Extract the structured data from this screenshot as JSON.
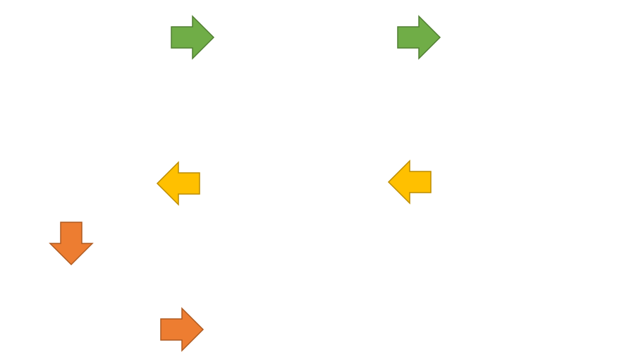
{
  "colors": {
    "green": {
      "fill": "#70AD47",
      "stroke": "#507E32"
    },
    "yellow": {
      "fill": "#FFC000",
      "stroke": "#BC8C00"
    },
    "orange": {
      "fill": "#ED7D31",
      "stroke": "#AE5A21"
    }
  },
  "arrows": [
    {
      "direction": "right",
      "color": "green"
    },
    {
      "direction": "right",
      "color": "green"
    },
    {
      "direction": "left",
      "color": "yellow"
    },
    {
      "direction": "left",
      "color": "yellow"
    },
    {
      "direction": "down",
      "color": "orange"
    },
    {
      "direction": "right",
      "color": "orange"
    }
  ]
}
